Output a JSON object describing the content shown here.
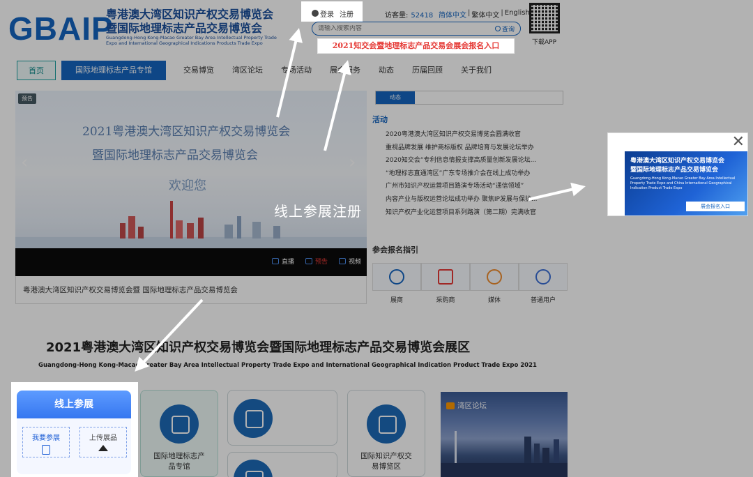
{
  "header": {
    "logo_text": "GBAIP",
    "site_title_line1": "粤港澳大湾区知识产权交易博览会",
    "site_title_line2": "暨国际地理标志产品交易博览会",
    "site_title_en": "Guangdong-Hong Kong-Macao Greater Bay Area Intellectual Property Trade Expo and International Geographical Indications Products Trade Expo",
    "login_label": "登录",
    "register_label": "注册",
    "visitors_label": "访客量:",
    "visitors_count": "52418",
    "lang_simplified": "简体中文",
    "lang_traditional": "繁体中文",
    "lang_english": "English",
    "search_placeholder": "请输入搜索内容",
    "search_button": "查询",
    "promo_link": "2021知交会暨地理标志产品交易会展会报名入口",
    "download_app": "下载APP"
  },
  "nav": {
    "home": "首页",
    "active": "国际地理标志产品专馆",
    "items": [
      "交易博览",
      "湾区论坛",
      "专场活动",
      "展会服务",
      "动态",
      "历届回顾",
      "关于我们"
    ]
  },
  "banner": {
    "tag": "预告",
    "title_line1": "2021粤港澳大湾区知识产权交易博览会",
    "title_line2": "暨国际地理标志产品交易博览会",
    "welcome": "欢迎您",
    "media_links": [
      "直播",
      "预告",
      "视频"
    ],
    "caption": "粤港澳大湾区知识产权交易博览会暨 国际地理标志产品交易博览会"
  },
  "news": {
    "tab": "动态",
    "category": "活动",
    "items": [
      "2020粤港澳大湾区知识产权交易博览会圆满收官",
      "重视品牌发展 维护商标版权 品牌培育与发展论坛举办",
      "2020知交会“专利信息情报支撑高质量创新发展论坛...",
      "“地理标志直通湾区”广东专场推介会在线上成功举办",
      "广州市知识产权运营项目路演专场活动“通信领域”",
      "内容产业与版权运营论坛成功举办 聚焦IP发展与保护...",
      "知识产权产业化运营项目系列路演（第二期）完满收官"
    ]
  },
  "guide": {
    "title": "参会报名指引",
    "items": [
      "展商",
      "采购商",
      "媒体",
      "普通用户"
    ]
  },
  "exhibition": {
    "title": "2021粤港澳大湾区知识产权交易博览会暨国际地理标志产品交易博览会展区",
    "subtitle": "Guangdong-Hong Kong-Macao Greater Bay Area Intellectual Property Trade Expo and  International Geographical Indication Product Trade Expo 2021",
    "card1": "国际地理标志产品专馆",
    "card3": "国际知识产权交易博览区",
    "bay_label": "湾区论坛"
  },
  "overlay": {
    "center_text": "线上参展注册",
    "popup_title1": "粤港澳大湾区知识产权交易博览会",
    "popup_title2": "暨国际地理标志产品交易博览会",
    "popup_en": "Guangdong-Hong Kong-Macao Greater Bay Area Intellectual Property Trade Expo and China International Geographical Indication Product Trade Expo",
    "popup_button": "展会报名入口",
    "popup_close": "✕",
    "online_title": "线上参展",
    "online_join": "我要参展",
    "online_upload": "上传展品"
  }
}
